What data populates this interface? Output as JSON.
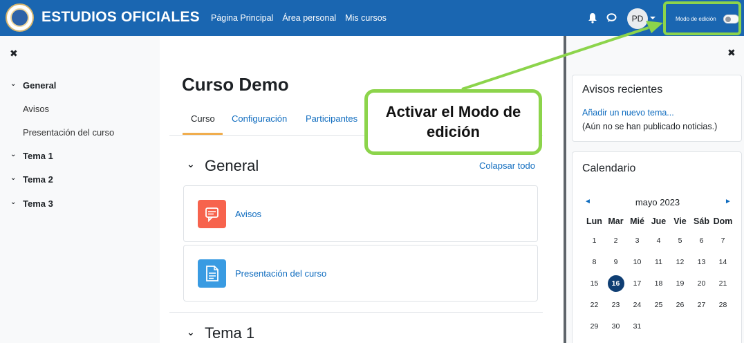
{
  "navbar": {
    "brand": "ESTUDIOS OFICIALES",
    "links": [
      "Página Principal",
      "Área personal",
      "Mis cursos"
    ],
    "avatar_initials": "PD",
    "edit_mode_label": "Modo de edición",
    "edit_mode_on": false,
    "bg_color": "#1a66b1"
  },
  "left_drawer": {
    "close_icon": "close-icon",
    "items": [
      {
        "label": "General",
        "type": "section"
      },
      {
        "label": "Avisos",
        "type": "activity"
      },
      {
        "label": "Presentación del curso",
        "type": "activity"
      },
      {
        "label": "Tema 1",
        "type": "section"
      },
      {
        "label": "Tema 2",
        "type": "section"
      },
      {
        "label": "Tema 3",
        "type": "section"
      }
    ]
  },
  "main": {
    "course_title": "Curso Demo",
    "tabs": [
      "Curso",
      "Configuración",
      "Participantes"
    ],
    "active_tab": "Curso",
    "collapse_all": "Colapsar todo",
    "sections": [
      {
        "title": "General",
        "activities": [
          {
            "label": "Avisos",
            "icon": "forum-icon",
            "color": "#f7634d"
          },
          {
            "label": "Presentación del curso",
            "icon": "page-icon",
            "color": "#399be2"
          }
        ]
      },
      {
        "title": "Tema 1",
        "activities": []
      }
    ]
  },
  "right_drawer": {
    "news": {
      "title": "Avisos recientes",
      "add_link": "Añadir un nuevo tema...",
      "empty_text": "(Aún no se han publicado noticias.)"
    },
    "calendar": {
      "title": "Calendario",
      "month": "mayo 2023",
      "days_header": [
        "Lun",
        "Mar",
        "Mié",
        "Jue",
        "Vie",
        "Sáb",
        "Dom"
      ],
      "weeks": [
        [
          "1",
          "2",
          "3",
          "4",
          "5",
          "6",
          "7"
        ],
        [
          "8",
          "9",
          "10",
          "11",
          "12",
          "13",
          "14"
        ],
        [
          "15",
          "16",
          "17",
          "18",
          "19",
          "20",
          "21"
        ],
        [
          "22",
          "23",
          "24",
          "25",
          "26",
          "27",
          "28"
        ],
        [
          "29",
          "30",
          "31",
          "",
          "",
          "",
          ""
        ]
      ],
      "today": "16"
    }
  },
  "annotation": {
    "text": "Activar el Modo de edición",
    "color": "#8cd44b"
  }
}
